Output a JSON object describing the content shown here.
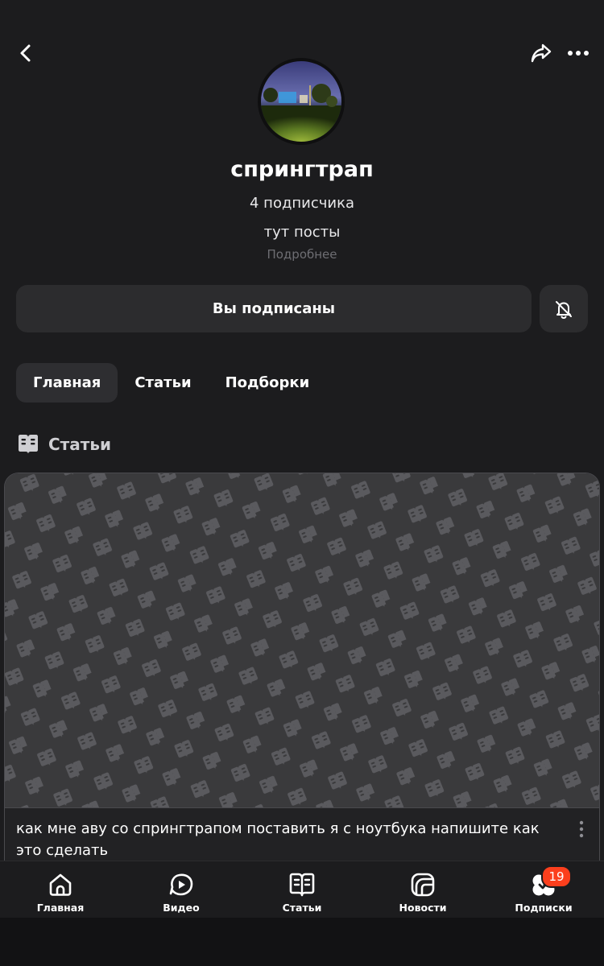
{
  "header": {
    "back_icon": "chevron-left-icon",
    "share_icon": "share-arrow-icon",
    "more_icon": "more-horizontal-icon"
  },
  "channel": {
    "name": "спрингтрап",
    "subscribers": "4 подписчика",
    "description": "тут посты",
    "more_link": "Подробнее"
  },
  "actions": {
    "subscribed_label": "Вы подписаны",
    "bell_icon": "bell-off-icon"
  },
  "tabs": [
    {
      "label": "Главная",
      "active": true
    },
    {
      "label": "Статьи",
      "active": false
    },
    {
      "label": "Подборки",
      "active": false
    }
  ],
  "section": {
    "title": "Статьи",
    "icon": "book-open-icon"
  },
  "article": {
    "title": "как мне аву со спрингтрапом поставить я с ноутбука напишите как это сделать",
    "menu_icon": "more-vertical-icon"
  },
  "bottom_nav": [
    {
      "label": "Главная",
      "icon": "home-icon"
    },
    {
      "label": "Видео",
      "icon": "video-play-icon"
    },
    {
      "label": "Статьи",
      "icon": "book-open-icon"
    },
    {
      "label": "Новости",
      "icon": "news-icon"
    },
    {
      "label": "Подписки",
      "icon": "subscriptions-icon",
      "badge": "19"
    }
  ],
  "colors": {
    "background": "#1c1c1e",
    "surface": "#2c2c2e",
    "accent_badge": "#fc3f1d",
    "muted_text": "#6e6e73"
  }
}
